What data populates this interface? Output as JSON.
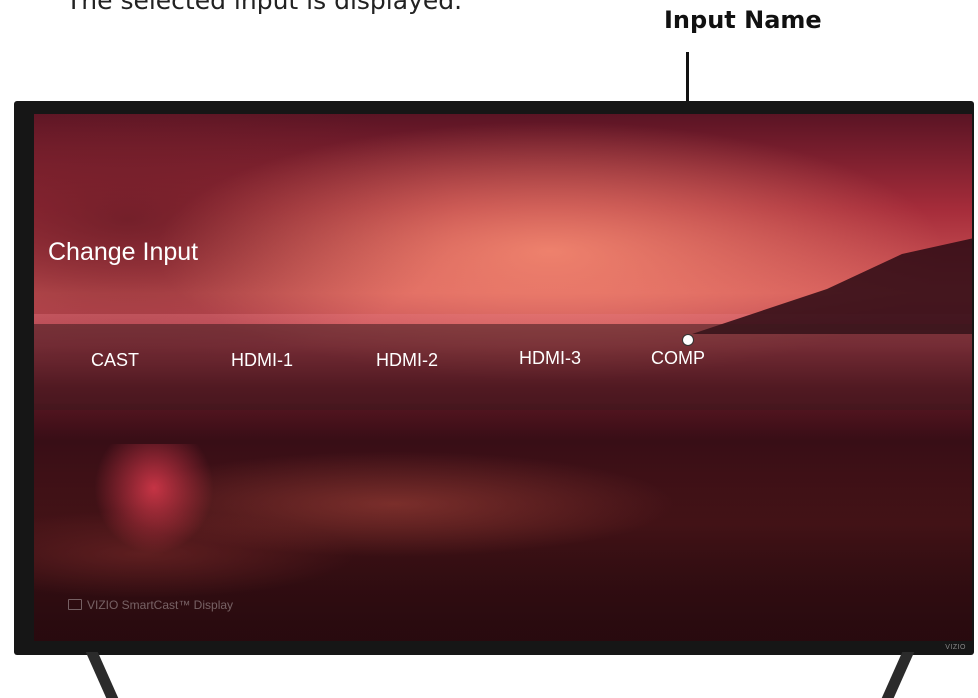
{
  "caption": "The selected input is displayed.",
  "callout": {
    "label": "Input Name"
  },
  "screen": {
    "title": "Change Input",
    "inputs": [
      "CAST",
      "HDMI-1",
      "HDMI-2",
      "HDMI-3",
      "COMP"
    ],
    "brand_mark": "VIZIO SmartCast™ Display"
  },
  "tv": {
    "logo": "VIZIO"
  },
  "colors": {
    "overlay_text": "#ffffff",
    "bezel": "#161616",
    "sunset": "#d25a5a"
  }
}
